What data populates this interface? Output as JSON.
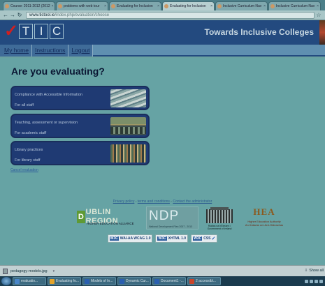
{
  "browser": {
    "tabs": [
      {
        "label": "Course: 2011-2012 (2012"
      },
      {
        "label": "problems with web tour"
      },
      {
        "label": "Evaluating for Inclusion"
      },
      {
        "label": "Evaluating for Inclusion"
      },
      {
        "label": "Inclusive Curriculum Nav"
      },
      {
        "label": "Inclusive Curriculum Nav"
      }
    ],
    "url_host": "www.tictool.ie",
    "url_path": "/index.php/evaluation/choose"
  },
  "site": {
    "logo_letters": [
      "T",
      "I",
      "C"
    ],
    "title": "Towards Inclusive Colleges"
  },
  "nav": {
    "items": [
      {
        "label": "My home"
      },
      {
        "label": "Instructions"
      },
      {
        "label": "Logout"
      }
    ]
  },
  "main": {
    "heading": "Are you evaluating?",
    "cards": [
      {
        "title": "Compliance with Accessible Information",
        "subtitle": "For all staff",
        "image": "office-shelves-image"
      },
      {
        "title": "Teaching, assessment or supervision",
        "subtitle": "For academic staff",
        "image": "classroom-image"
      },
      {
        "title": "Library practices",
        "subtitle": "For library staff",
        "image": "library-image"
      }
    ],
    "cancel_label": "Cancel evaluation"
  },
  "footer": {
    "links": [
      {
        "label": "Privacy policy"
      },
      {
        "label": "terms and conditions"
      },
      {
        "label": "Contact the administrator"
      }
    ],
    "separator": " - ",
    "logos": {
      "dublin_main": "UBLIN REGION",
      "dublin_letter": "D",
      "dublin_sub": "HIGHER EDUCATION ALLIANCE",
      "ndp_main": "NDP",
      "ndp_sub": "National Development Plan 2007 - 2013",
      "gov_sub": "Rialtas na hÉireann / Government of Ireland",
      "hea_main": "HEA",
      "hea_sub1": "Higher Education Authority",
      "hea_sub2": "An tÚdarás um Ard-Oideachas"
    },
    "badges": [
      {
        "w3": "W3C",
        "label": "WAI-AA WCAG 1.0"
      },
      {
        "w3": "W3C",
        "label": "XHTML 1.0"
      },
      {
        "w3": "W3C",
        "label": "CSS"
      }
    ]
  },
  "downloads": {
    "file_name": "pedagogy-models.jpg",
    "show_all": "Show all"
  },
  "taskbar": {
    "tasks": [
      {
        "label": "evaluatio...",
        "color": "#4a86c9"
      },
      {
        "label": "Evaluating fo...",
        "color": "#e3a32b"
      },
      {
        "label": "Models of In...",
        "color": "#2b5fb0"
      },
      {
        "label": "Dynamic Cur...",
        "color": "#2b5fb0"
      },
      {
        "label": "Document1 -...",
        "color": "#2b5fb0"
      },
      {
        "label": "2 accessibl...",
        "color": "#c9452b"
      }
    ]
  }
}
